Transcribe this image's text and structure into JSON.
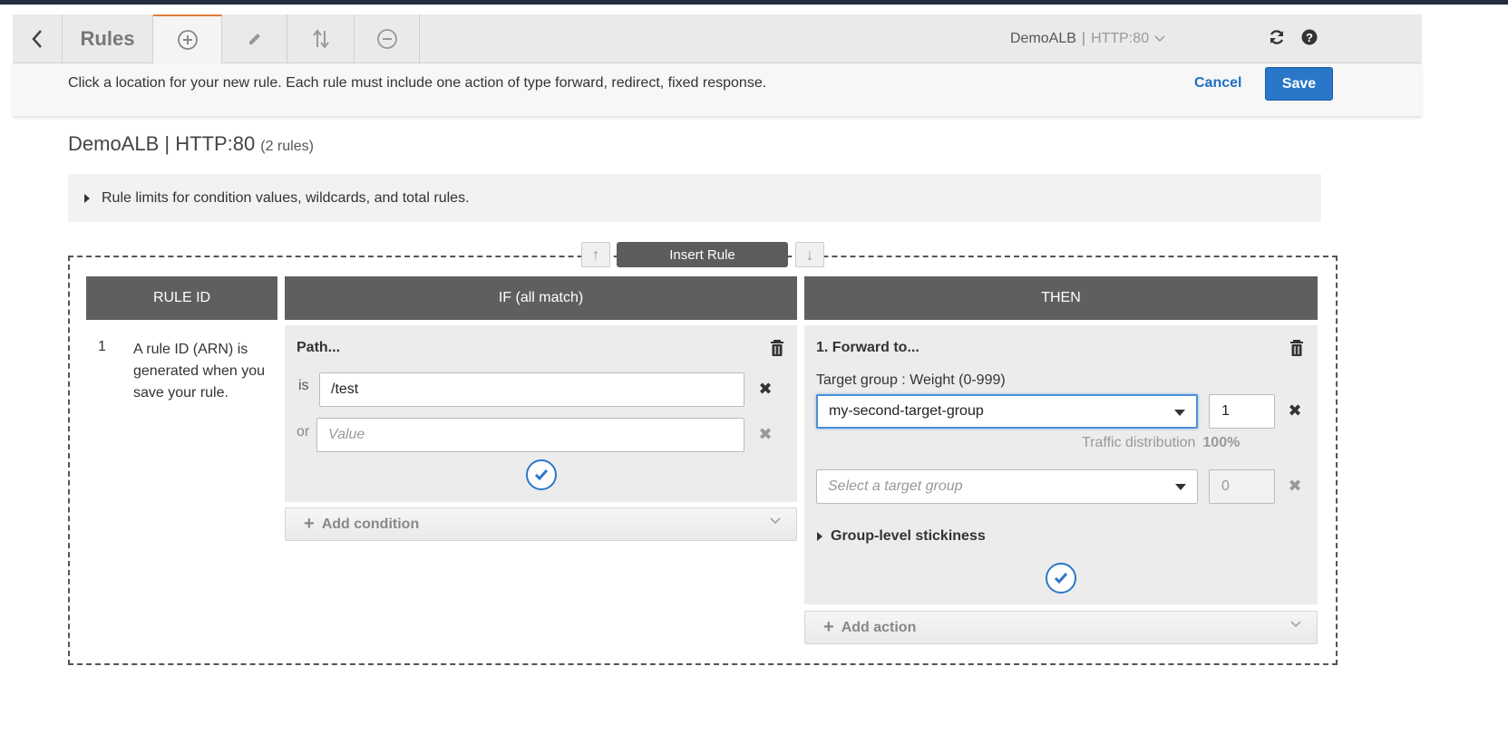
{
  "toolbar": {
    "rules_label": "Rules",
    "listener_name": "DemoALB",
    "listener_sep": "|",
    "listener_port": "HTTP:80"
  },
  "infobar": {
    "message": "Click a location for your new rule. Each rule must include one action of type forward, redirect, fixed response.",
    "cancel_label": "Cancel",
    "save_label": "Save"
  },
  "page": {
    "title": "DemoALB | HTTP:80",
    "rule_count": "(2 rules)",
    "limits_label": "Rule limits for condition values, wildcards, and total rules."
  },
  "insert": {
    "label": "Insert Rule"
  },
  "table": {
    "headers": [
      "RULE ID",
      "IF (all match)",
      "THEN"
    ]
  },
  "rule": {
    "number": "1",
    "description": "A rule ID (ARN) is generated when you save your rule.",
    "condition": {
      "title": "Path...",
      "is_label": "is",
      "value": "/test",
      "or_label": "or",
      "value_placeholder": "Value"
    },
    "add_condition_label": "Add condition",
    "action": {
      "title": "1. Forward to...",
      "target_label": "Target group : Weight (0-999)",
      "target_selected": "my-second-target-group",
      "weight_1": "1",
      "traffic_label": "Traffic distribution",
      "traffic_value": "100%",
      "target_placeholder": "Select a target group",
      "weight_2": "0",
      "stickiness_label": "Group-level stickiness"
    },
    "add_action_label": "Add action"
  },
  "colors": {
    "accent": "#2a77c9",
    "header": "#5f5f5f",
    "active_tab": "#e07b39"
  }
}
